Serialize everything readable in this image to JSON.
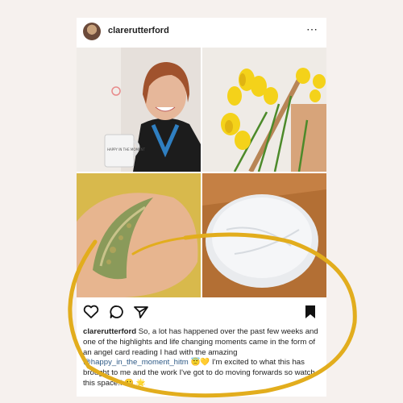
{
  "post": {
    "username": "clarerutterford",
    "more_icon": "⋯"
  },
  "images": [
    {
      "name": "photo-woman-with-mug",
      "alt": ""
    },
    {
      "name": "photo-yellow-flowers",
      "alt": ""
    },
    {
      "name": "photo-crystal-moon-in-hand",
      "alt": ""
    },
    {
      "name": "photo-selenite-disc",
      "alt": ""
    }
  ],
  "mug_text": "HAPPY IN THE MOMENT",
  "caption": {
    "username": "clarerutterford",
    "text_before_mention": " So, a lot has happened over the past few weeks and one of the highlights and life changing moments came in the form of an angel card reading I had with the amazing ",
    "mention": "@happy_in_the_moment_hitm",
    "text_after_mention": " 😇💛 I'm excited to what this has brought to me and the work I've got to do moving forwards so watch this space!! 😀 🌟"
  },
  "colors": {
    "background": "#f6f1ee",
    "accent_swoosh": "#e2ad1d",
    "mention": "#2e5a86"
  },
  "icons": [
    "heart-icon",
    "comment-icon",
    "share-icon",
    "bookmark-icon",
    "more-icon"
  ]
}
